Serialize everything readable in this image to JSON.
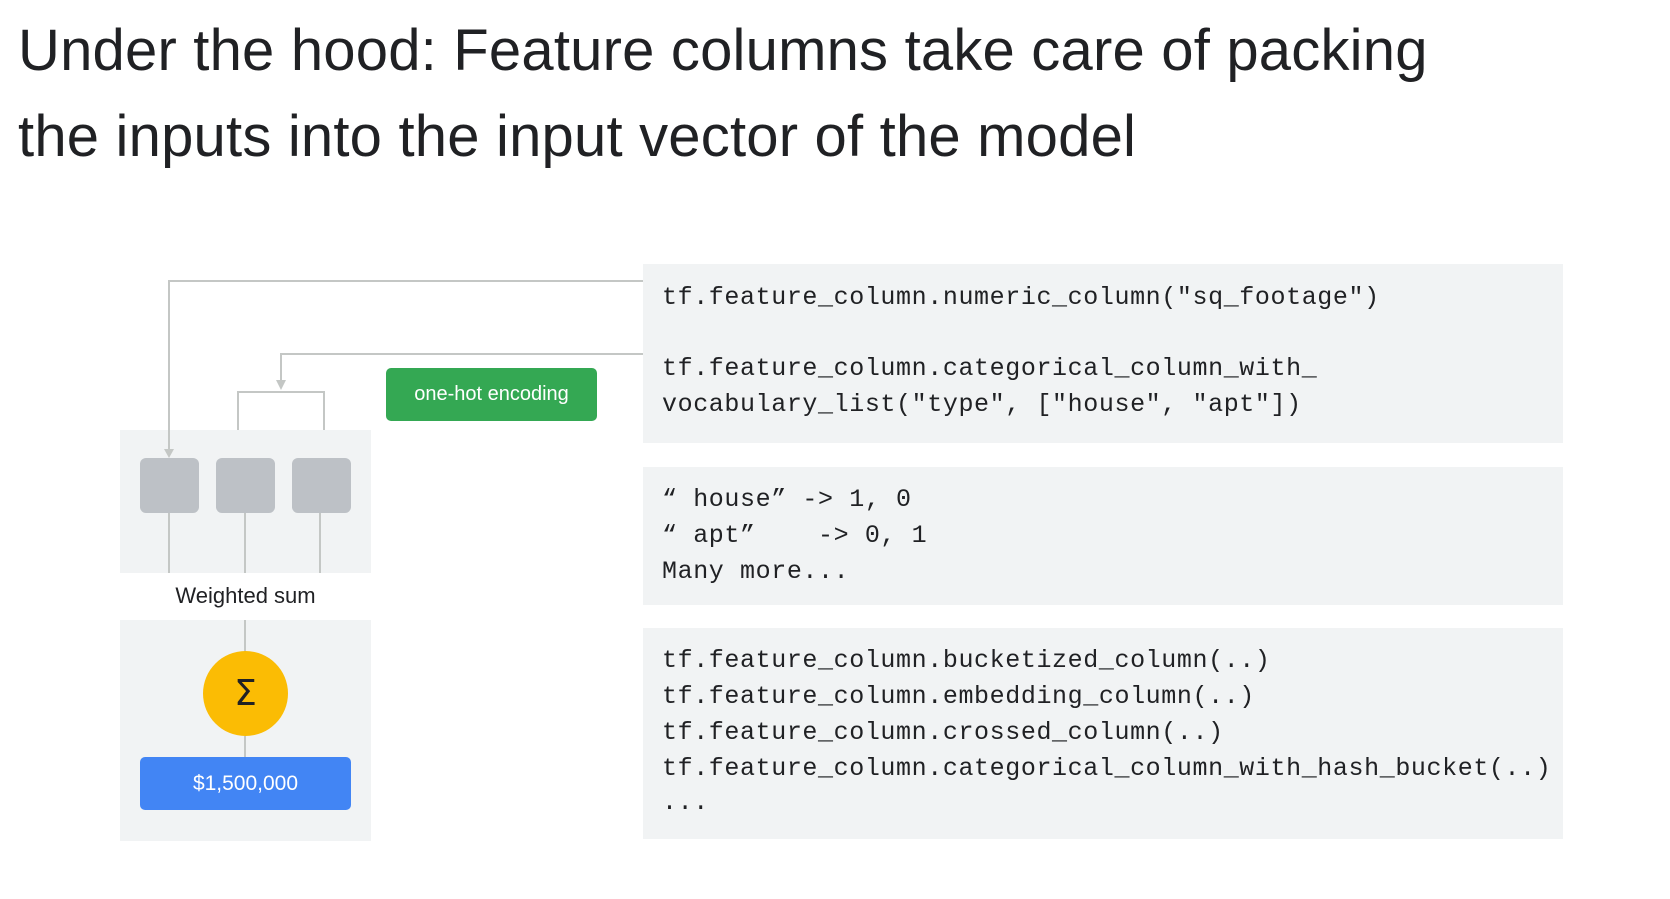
{
  "slide": {
    "title_line1": "Under the hood: Feature columns take care of packing",
    "title_line2": "the inputs into the input vector of the model"
  },
  "diagram": {
    "onehot_label": "one-hot encoding",
    "weighted_sum_label": "Weighted sum",
    "sigma_symbol": "Σ",
    "output_value": "$1,500,000",
    "colors": {
      "panel": "#f1f3f4",
      "node": "#bdc1c6",
      "connector": "#c4c7c5",
      "sigma": "#fbbc04",
      "output": "#4285f4",
      "onehot": "#34a853"
    }
  },
  "code": {
    "block1": [
      "tf.feature_column.numeric_column(\"sq_footage\")",
      "tf.feature_column.categorical_column_with_",
      "vocabulary_list(\"type\", [\"house\", \"apt\"])"
    ],
    "block2": [
      "“ house” -> 1, 0",
      "“ apt”    -> 0, 1",
      "Many more..."
    ],
    "block3": [
      "tf.feature_column.bucketized_column(..)",
      "tf.feature_column.embedding_column(..)",
      "tf.feature_column.crossed_column(..)",
      "tf.feature_column.categorical_column_with_hash_bucket(..)",
      "..."
    ]
  }
}
